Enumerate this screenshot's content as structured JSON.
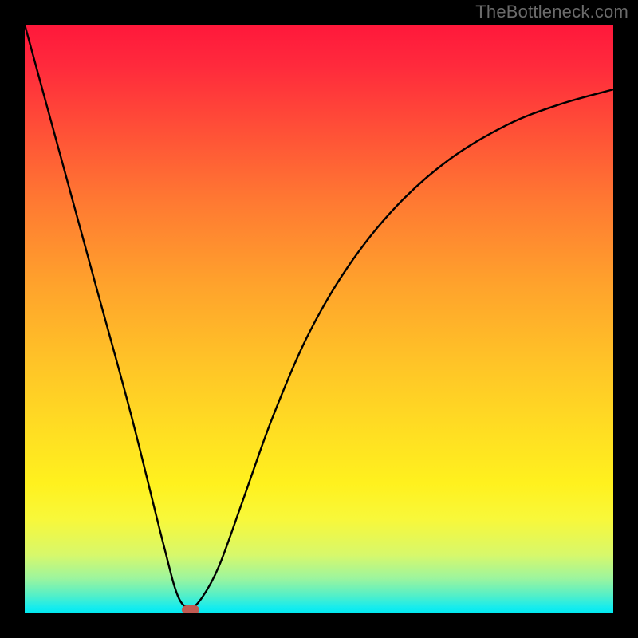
{
  "watermark": "TheBottleneck.com",
  "chart_data": {
    "type": "line",
    "title": "",
    "xlabel": "",
    "ylabel": "",
    "xlim": [
      0,
      1
    ],
    "ylim": [
      0,
      1
    ],
    "series": [
      {
        "name": "curve",
        "x": [
          0.0,
          0.06,
          0.12,
          0.18,
          0.235,
          0.26,
          0.28,
          0.3,
          0.33,
          0.37,
          0.42,
          0.48,
          0.55,
          0.63,
          0.72,
          0.82,
          0.91,
          1.0
        ],
        "y": [
          1.0,
          0.78,
          0.56,
          0.34,
          0.12,
          0.03,
          0.01,
          0.025,
          0.08,
          0.19,
          0.33,
          0.47,
          0.59,
          0.69,
          0.77,
          0.83,
          0.865,
          0.89
        ]
      }
    ],
    "minimum_marker": {
      "x": 0.282,
      "y": 0.006
    },
    "grid": false,
    "legend": false
  }
}
